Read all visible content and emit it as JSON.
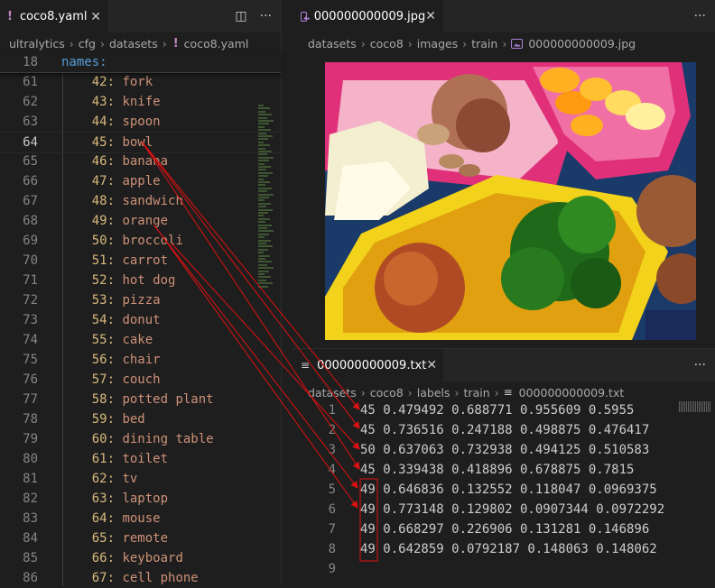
{
  "left_editor": {
    "tab_title": "coco8.yaml",
    "breadcrumb": [
      "ultralytics",
      "cfg",
      "datasets",
      "coco8.yaml"
    ],
    "sticky_line": {
      "num": "18",
      "key": "names:"
    },
    "active_line": "64",
    "lines": [
      {
        "num": "61",
        "key": "42:",
        "val": "fork"
      },
      {
        "num": "62",
        "key": "43:",
        "val": "knife"
      },
      {
        "num": "63",
        "key": "44:",
        "val": "spoon"
      },
      {
        "num": "64",
        "key": "45:",
        "val": "bowl"
      },
      {
        "num": "65",
        "key": "46:",
        "val": "banana"
      },
      {
        "num": "66",
        "key": "47:",
        "val": "apple"
      },
      {
        "num": "67",
        "key": "48:",
        "val": "sandwich"
      },
      {
        "num": "68",
        "key": "49:",
        "val": "orange"
      },
      {
        "num": "69",
        "key": "50:",
        "val": "broccoli"
      },
      {
        "num": "70",
        "key": "51:",
        "val": "carrot"
      },
      {
        "num": "71",
        "key": "52:",
        "val": "hot dog"
      },
      {
        "num": "72",
        "key": "53:",
        "val": "pizza"
      },
      {
        "num": "73",
        "key": "54:",
        "val": "donut"
      },
      {
        "num": "74",
        "key": "55:",
        "val": "cake"
      },
      {
        "num": "75",
        "key": "56:",
        "val": "chair"
      },
      {
        "num": "76",
        "key": "57:",
        "val": "couch"
      },
      {
        "num": "77",
        "key": "58:",
        "val": "potted plant"
      },
      {
        "num": "78",
        "key": "59:",
        "val": "bed"
      },
      {
        "num": "79",
        "key": "60:",
        "val": "dining table"
      },
      {
        "num": "80",
        "key": "61:",
        "val": "toilet"
      },
      {
        "num": "81",
        "key": "62:",
        "val": "tv"
      },
      {
        "num": "82",
        "key": "63:",
        "val": "laptop"
      },
      {
        "num": "83",
        "key": "64:",
        "val": "mouse"
      },
      {
        "num": "84",
        "key": "65:",
        "val": "remote"
      },
      {
        "num": "85",
        "key": "66:",
        "val": "keyboard"
      },
      {
        "num": "86",
        "key": "67:",
        "val": "cell phone"
      }
    ]
  },
  "image_editor": {
    "tab_title": "000000000009.jpg",
    "breadcrumb": [
      "datasets",
      "coco8",
      "images",
      "train",
      "000000000009.jpg"
    ]
  },
  "text_editor": {
    "tab_title": "000000000009.txt",
    "breadcrumb": [
      "datasets",
      "coco8",
      "labels",
      "train",
      "000000000009.txt"
    ],
    "lines": [
      {
        "num": "1",
        "text": "45 0.479492 0.688771 0.955609 0.5955"
      },
      {
        "num": "2",
        "text": "45 0.736516 0.247188 0.498875 0.476417"
      },
      {
        "num": "3",
        "text": "50 0.637063 0.732938 0.494125 0.510583"
      },
      {
        "num": "4",
        "text": "45 0.339438 0.418896 0.678875 0.7815"
      },
      {
        "num": "5",
        "text": "49 0.646836 0.132552 0.118047 0.0969375"
      },
      {
        "num": "6",
        "text": "49 0.773148 0.129802 0.0907344 0.0972292"
      },
      {
        "num": "7",
        "text": "49 0.668297 0.226906 0.131281 0.146896"
      },
      {
        "num": "8",
        "text": "49 0.642859 0.0792187 0.148063 0.148062"
      },
      {
        "num": "9",
        "text": ""
      }
    ]
  },
  "colors": {
    "annotation_arrow": "#e01010",
    "yaml_key": "#569cd6",
    "yaml_value": "#ce9178",
    "line_number": "#858585"
  }
}
